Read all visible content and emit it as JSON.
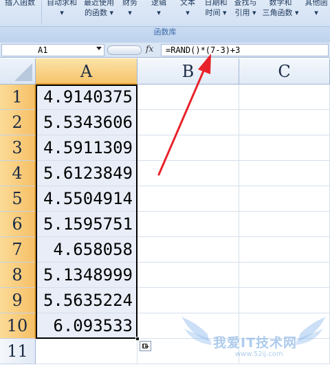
{
  "ribbon": {
    "buttons": [
      {
        "line1": "插入函数",
        "line2": ""
      },
      {
        "line1": "自动求和",
        "line2": "▾"
      },
      {
        "line1": "最近使用",
        "line2": "的函数 ▾"
      },
      {
        "line1": "财务",
        "line2": "▾"
      },
      {
        "line1": "逻辑",
        "line2": "▾"
      },
      {
        "line1": "文本",
        "line2": "▾"
      },
      {
        "line1": "日期和",
        "line2": "时间 ▾"
      },
      {
        "line1": "查找与",
        "line2": "引用 ▾"
      },
      {
        "line1": "数学和",
        "line2": "三角函数 ▾"
      },
      {
        "line1": "其他函",
        "line2": "▾"
      }
    ],
    "group_label": "函数库"
  },
  "formula_bar": {
    "name_box": "A1",
    "fx_label": "fx",
    "formula": "=RAND()*(7-3)+3"
  },
  "columns": [
    "A",
    "B",
    "C"
  ],
  "rows": [
    {
      "num": "1",
      "a": "4.9140375"
    },
    {
      "num": "2",
      "a": "5.5343606"
    },
    {
      "num": "3",
      "a": "4.5911309"
    },
    {
      "num": "4",
      "a": "5.6123849"
    },
    {
      "num": "5",
      "a": "4.5504914"
    },
    {
      "num": "6",
      "a": "5.1595751"
    },
    {
      "num": "7",
      "a": "4.658058"
    },
    {
      "num": "8",
      "a": "5.1348999"
    },
    {
      "num": "9",
      "a": "5.5635224"
    },
    {
      "num": "10",
      "a": "6.093533"
    },
    {
      "num": "11",
      "a": ""
    }
  ],
  "watermark": {
    "text": "我爱IT技术网",
    "url": "www.52ij.com"
  },
  "colors": {
    "arrow": "#e8222a",
    "selected_header": "#f6c36b",
    "selected_cells": "#e8edf7"
  },
  "icons": {
    "fill_handle": "autofill-options-icon",
    "namebox_dropdown": "chevron-down-icon"
  }
}
